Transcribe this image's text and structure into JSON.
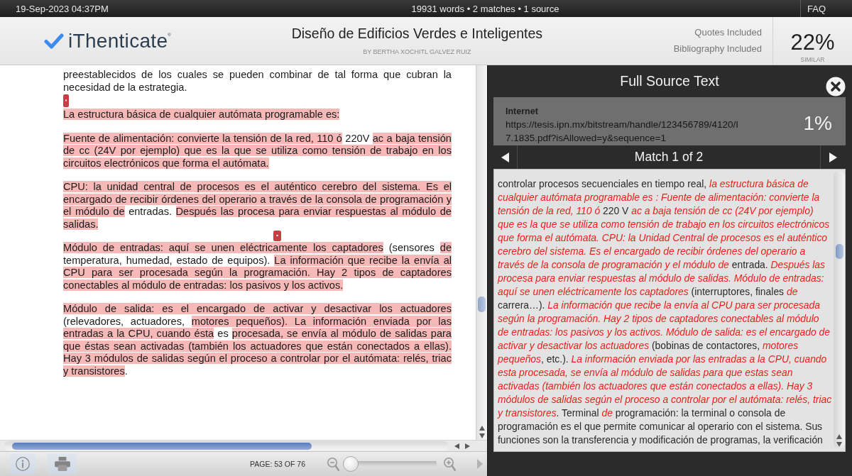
{
  "top_bar": {
    "datetime": "19-Sep-2023 04:37PM",
    "stats": "19931 words • 2 matches • 1 source",
    "faq": "FAQ"
  },
  "header": {
    "logo": "iThenticate$^{®}$",
    "title": "Diseño de Edificios Verdes e Inteligentes",
    "author": "BY BERTHA XOCHITL GALVEZ RUIZ",
    "filters": [
      "Quotes Included",
      "Bibliography Included"
    ],
    "similarity": {
      "value": "22%",
      "label": "SIMILAR"
    }
  },
  "document": {
    "paragraphs": [
      {
        "kind": "plain",
        "segments": [
          {
            "text": "preestablecidos de los cuales se pueden combinar de tal forma que cubran la necesidad de la estrategia.",
            "matched": false
          }
        ]
      },
      {
        "kind": "start_marker",
        "segments": [
          {
            "text": "La estructura básica de cualquier autómata programable es:",
            "matched": true
          }
        ]
      },
      {
        "kind": "plain",
        "segments": [
          {
            "text": "Fuente de alimentación: convierte la tensión de la red, 110 ó",
            "matched": true
          },
          {
            "text": " 220V ",
            "matched": false
          },
          {
            "text": "ac a baja tensión de cc (24V por ejemplo) que es la que se utiliza como tensión de trabajo en los circuitos electrónicos que forma el autómata.",
            "matched": true
          }
        ]
      },
      {
        "kind": "plain",
        "segments": [
          {
            "text": "CPU: la unidad central de procesos es el auténtico cerebro del sistema. Es el encargado de recibir órdenes del operario a través de la consola de programación y el módulo de",
            "matched": true
          },
          {
            "text": " entradas. ",
            "matched": false
          },
          {
            "text": "Después las procesa para enviar respuestas al módulo de salidas.",
            "matched": true
          }
        ]
      },
      {
        "kind": "inline_marker",
        "segments": [
          {
            "text": "Módulo de entradas: aquí se unen eléctricamente los captadores",
            "matched": true
          },
          {
            "text": " (sensores ",
            "matched": false
          },
          {
            "text": "de",
            "matched": true
          },
          {
            "text": " temperatura, humedad, estado de equipos). ",
            "matched": false
          },
          {
            "text": "La información que recibe la envía al CPU para ser procesada según la programación. Hay 2 tipos de captadores conectables al módulo de entradas: los pasivos y los activos.",
            "matched": true
          }
        ]
      },
      {
        "kind": "plain",
        "segments": [
          {
            "text": "Módulo de salida: es el encargado de activar y desactivar los actuadores",
            "matched": true
          },
          {
            "text": " (relevadores, actuadores, ",
            "matched": false
          },
          {
            "text": "motores pequeños). La información enviada por las entradas a la CPU, cuando ésta",
            "matched": true
          },
          {
            "text": " es ",
            "matched": false
          },
          {
            "text": "procesada, se envía al módulo de salidas para que éstas sean activadas (también los actuadores que están conectados a ellas). Hay 3 módulos de salidas según el proceso a controlar por el autómata: relés, triac y transistores",
            "matched": true
          },
          {
            "text": ".",
            "matched": false
          }
        ]
      }
    ]
  },
  "toolbar": {
    "page": "PAGE: 53 OF 76",
    "zoom": {
      "level": 0
    }
  },
  "source_panel": {
    "title": "Full Source Text",
    "source": {
      "type": "Internet",
      "url": "https://tesis.ipn.mx/bitstream/handle/123456789/4120/I7.1835.pdf?isAllowed=y&sequence=1",
      "percent": "1%"
    },
    "match_nav": "Match 1 of 2",
    "segments": [
      {
        "text": "controlar procesos secuenciales en tiempo real, ",
        "matched": false
      },
      {
        "text": "la estructura básica de cualquier autómata programable es : Fuente de alimentación: convierte la tensión de la red, 110 ó",
        "matched": true
      },
      {
        "text": " 220 V ",
        "matched": false
      },
      {
        "text": "ac a baja tensión de cc (24V por ejemplo) que es la que se utiliza como tensión de trabajo en los circuitos electrónicos que forma el autómata. CPU: la Unidad Central de procesos es el auténtico cerebro del sistema. Es el encargado de recibir órdenes del operario a través de la consola de programación y el módulo de",
        "matched": true
      },
      {
        "text": " entrada. ",
        "matched": false
      },
      {
        "text": "Después las procesa para enviar respuestas al módulo de salidas. Módulo de entradas: aquí se unen eléctricamente los captadores",
        "matched": true
      },
      {
        "text": " (interruptores, finales ",
        "matched": false
      },
      {
        "text": "de",
        "matched": true
      },
      {
        "text": " carrera…). ",
        "matched": false
      },
      {
        "text": "La información que recibe la envía al CPU para ser procesada según la programación. Hay 2 tipos de captadores conectables al módulo de entradas: los pasivos y los activos. Módulo de salida: es el encargado de activar y desactivar los actuadores",
        "matched": true
      },
      {
        "text": " (bobinas de contactores, ",
        "matched": false
      },
      {
        "text": "motores pequeños",
        "matched": true
      },
      {
        "text": ", etc.). ",
        "matched": false
      },
      {
        "text": "La información enviada por las entradas a la CPU, cuando esta procesada, se envía al módulo de salidas para que estas sean activadas (también los actuadores que están conectados a ellas). Hay 3 módulos de salidas según el proceso a controlar por el autómata: relés, triac y transistores",
        "matched": true
      },
      {
        "text": ". Terminal ",
        "matched": false
      },
      {
        "text": "de",
        "matched": true
      },
      {
        "text": " programación: la terminal o consola de programación es el que permite comunicar al operario con el sistema. Sus funciones son la transferencia y modificación de programas, la verificación",
        "matched": false
      }
    ]
  }
}
